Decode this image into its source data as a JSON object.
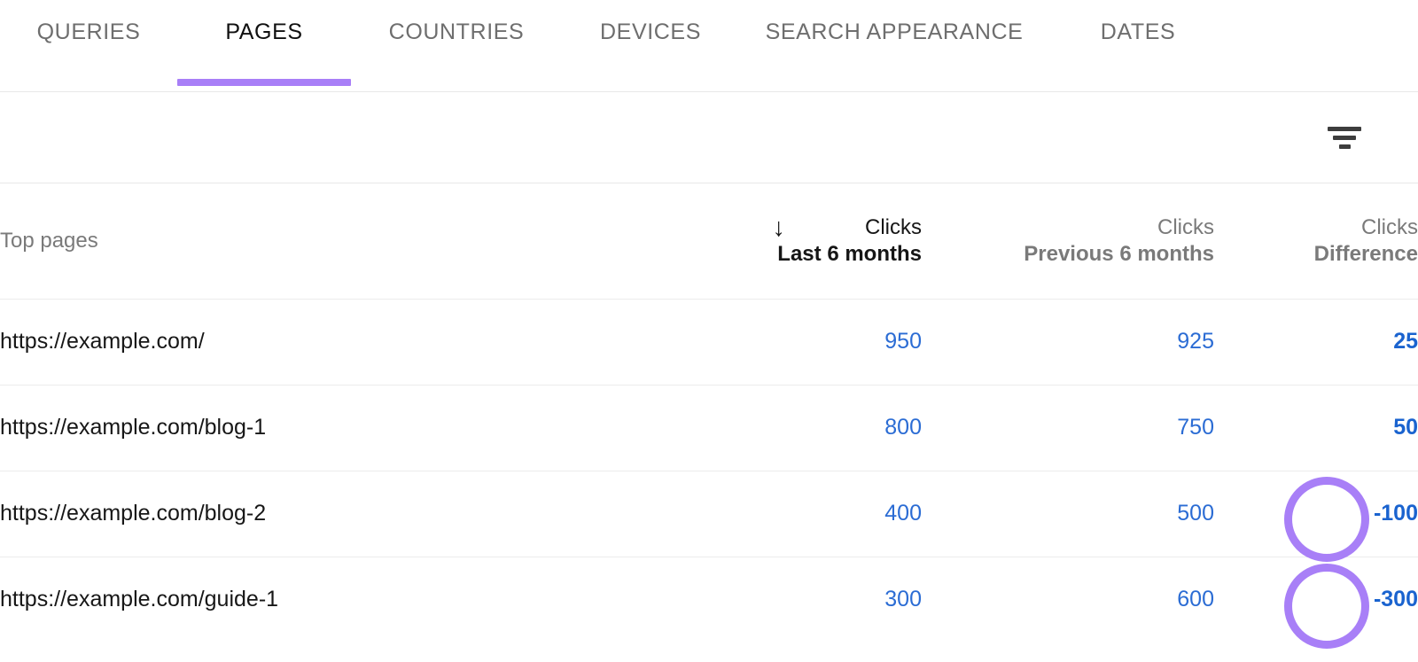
{
  "tabs": [
    {
      "label": "QUERIES",
      "active": false
    },
    {
      "label": "PAGES",
      "active": true
    },
    {
      "label": "COUNTRIES",
      "active": false
    },
    {
      "label": "DEVICES",
      "active": false
    },
    {
      "label": "SEARCH APPEARANCE",
      "active": false
    },
    {
      "label": "DATES",
      "active": false
    }
  ],
  "toolbar": {
    "filter_icon": "filter-icon"
  },
  "table": {
    "columns": {
      "page": "Top pages",
      "last": {
        "line1": "Clicks",
        "line2": "Last 6 months",
        "sort_arrow": "↓"
      },
      "previous": {
        "line1": "Clicks",
        "line2": "Previous 6 months"
      },
      "difference": {
        "line1": "Clicks",
        "line2": "Difference"
      }
    },
    "rows": [
      {
        "page": "https://example.com/",
        "last": "950",
        "previous": "925",
        "difference": "25",
        "highlighted": false
      },
      {
        "page": "https://example.com/blog-1",
        "last": "800",
        "previous": "750",
        "difference": "50",
        "highlighted": false
      },
      {
        "page": "https://example.com/blog-2",
        "last": "400",
        "previous": "500",
        "difference": "-100",
        "highlighted": true
      },
      {
        "page": "https://example.com/guide-1",
        "last": "300",
        "previous": "600",
        "difference": "-300",
        "highlighted": true
      }
    ]
  },
  "colors": {
    "accent_purple": "#a87ff7",
    "link_blue": "#2b6cd4",
    "text_dark": "#161616",
    "text_grey": "#7a7a7a",
    "divider": "#ececec"
  }
}
